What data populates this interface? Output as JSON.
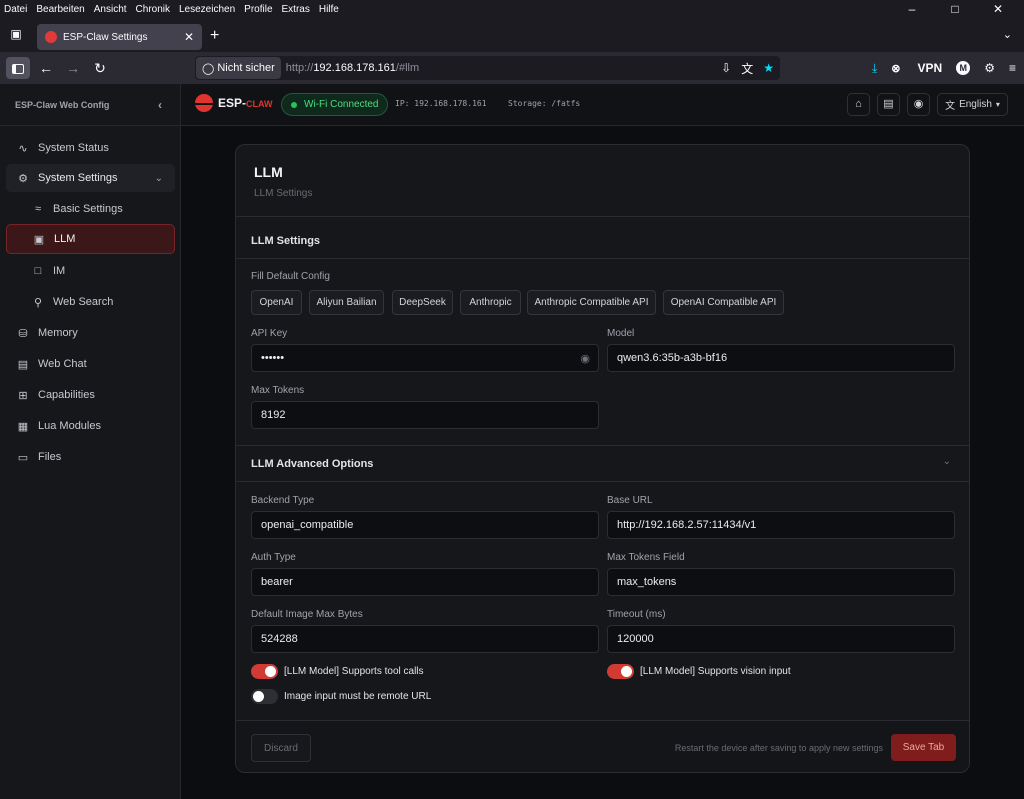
{
  "browser": {
    "menu": [
      "Datei",
      "Bearbeiten",
      "Ansicht",
      "Chronik",
      "Lesezeichen",
      "Profile",
      "Extras",
      "Hilfe"
    ],
    "tab_title": "ESP-Claw Settings",
    "not_secure": "Nicht sicher",
    "url_prefix": "http://",
    "url_host": "192.168.178.161",
    "url_path": "/#llm",
    "vpn_label": "VPN",
    "account_initial": "M",
    "colors": {
      "accent": "#00ddff"
    }
  },
  "sidebar": {
    "title": "ESP-Claw Web Config",
    "items": [
      {
        "label": "System Status",
        "icon": "activity-icon"
      },
      {
        "label": "System Settings",
        "icon": "gear-icon"
      },
      {
        "label": "Basic Settings",
        "icon": "wifi-icon"
      },
      {
        "label": "LLM",
        "icon": "robot-icon"
      },
      {
        "label": "IM",
        "icon": "chat-icon"
      },
      {
        "label": "Web Search",
        "icon": "search-icon"
      },
      {
        "label": "Memory",
        "icon": "database-icon"
      },
      {
        "label": "Web Chat",
        "icon": "messages-icon"
      },
      {
        "label": "Capabilities",
        "icon": "blocks-icon"
      },
      {
        "label": "Lua Modules",
        "icon": "file-code-icon"
      },
      {
        "label": "Files",
        "icon": "folder-icon"
      }
    ]
  },
  "topbar": {
    "logo_main": "ESP-",
    "logo_accent": "CLAW",
    "wifi_status": "Wi-Fi Connected",
    "ip": "IP: 192.168.178.161",
    "storage": "Storage: /fatfs",
    "language": "English",
    "colors": {
      "brand": "#e0342f",
      "connected": "#4ade80"
    }
  },
  "card": {
    "title": "LLM",
    "subtitle": "LLM Settings",
    "section1_title": "LLM Settings",
    "fill_default_label": "Fill Default Config",
    "presets": [
      "OpenAI",
      "Aliyun Bailian",
      "DeepSeek",
      "Anthropic",
      "Anthropic Compatible API",
      "OpenAI Compatible API"
    ],
    "api_key_label": "API Key",
    "api_key_value": "••••••",
    "model_label": "Model",
    "model_value": "qwen3.6:35b-a3b-bf16",
    "max_tokens_label": "Max Tokens",
    "max_tokens_value": "8192",
    "section2_title": "LLM Advanced Options",
    "backend_type_label": "Backend Type",
    "backend_type_value": "openai_compatible",
    "base_url_label": "Base URL",
    "base_url_value": "http://192.168.2.57:11434/v1",
    "auth_type_label": "Auth Type",
    "auth_type_value": "bearer",
    "max_tokens_field_label": "Max Tokens Field",
    "max_tokens_field_value": "max_tokens",
    "image_max_bytes_label": "Default Image Max Bytes",
    "image_max_bytes_value": "524288",
    "timeout_label": "Timeout (ms)",
    "timeout_value": "120000",
    "toggle_tool_calls": {
      "label": "[LLM Model] Supports tool calls",
      "on": true
    },
    "toggle_vision": {
      "label": "[LLM Model] Supports vision input",
      "on": true
    },
    "toggle_remote_url": {
      "label": "Image input must be remote URL",
      "on": false
    },
    "discard_label": "Discard",
    "hint": "Restart the device after saving to apply new settings",
    "save_label": "Save Tab",
    "colors": {
      "toggle_on": "#d23b34",
      "save_bg": "#7f1d1d"
    }
  }
}
